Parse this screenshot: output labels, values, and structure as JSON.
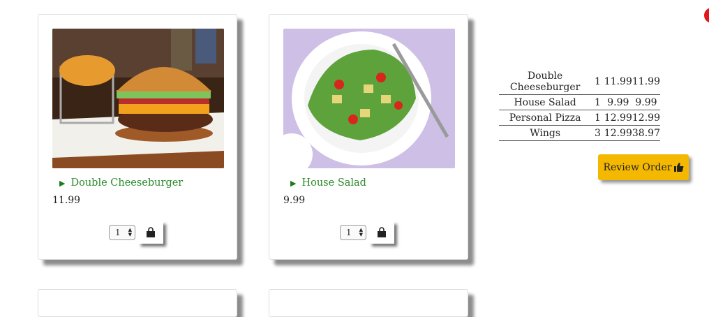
{
  "products": [
    {
      "name": "Double Cheeseburger",
      "price": "11.99",
      "quantity": "1",
      "image": "cheeseburger-photo"
    },
    {
      "name": "House Salad",
      "price": "9.99",
      "quantity": "1",
      "image": "salad-photo"
    }
  ],
  "order_summary": {
    "rows": [
      {
        "item": "Double Cheeseburger",
        "qty": "1",
        "unit": "11.99",
        "total": "11.99"
      },
      {
        "item": "House Salad",
        "qty": "1",
        "unit": "9.99",
        "total": "9.99"
      },
      {
        "item": "Personal Pizza",
        "qty": "1",
        "unit": "12.99",
        "total": "12.99"
      },
      {
        "item": "Wings",
        "qty": "3",
        "unit": "12.99",
        "total": "38.97"
      }
    ]
  },
  "review_button": {
    "label": "Review Order",
    "icon": "thumbs-up-icon"
  },
  "icons": {
    "add_to_cart": "shopping-bag-icon",
    "expand": "caret-right-icon"
  },
  "colors": {
    "link_green": "#2a8a2a",
    "button_yellow": "#f5b800",
    "notification_red": "#e3161b"
  }
}
